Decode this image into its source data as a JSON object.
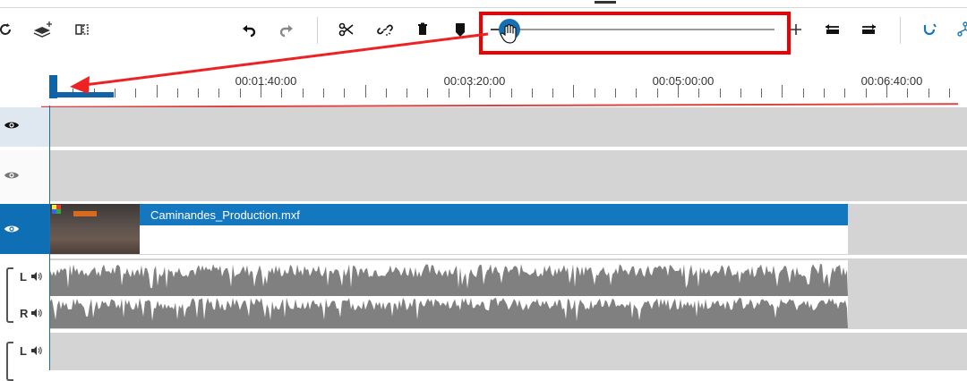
{
  "timecode_fragment": "00",
  "ruler": {
    "labels": [
      "00:01:40:00",
      "00:03:20:00",
      "00:05:00:00",
      "00:06:40:00"
    ]
  },
  "toolbar": {
    "icons": [
      "reset-icon",
      "add-track-icon",
      "split-view-icon",
      "undo-icon",
      "redo-icon",
      "scissors-icon",
      "unlink-icon",
      "delete-icon",
      "marker-icon",
      "zoom-slider",
      "zoom-in-icon",
      "align-left-icon",
      "align-right-icon",
      "magnet-icon",
      "grid-icon"
    ]
  },
  "zoom": {
    "level": 0.03
  },
  "tracks": {
    "video_clip": {
      "name": "Caminandes_Production.mxf"
    },
    "audio": {
      "left_label": "L",
      "right_label": "R",
      "second_left_label": "L"
    }
  },
  "colors": {
    "accent": "#1478c0",
    "highlight": "#ee0000",
    "track_bg": "#d4d4d4",
    "waveform": "#808080"
  }
}
